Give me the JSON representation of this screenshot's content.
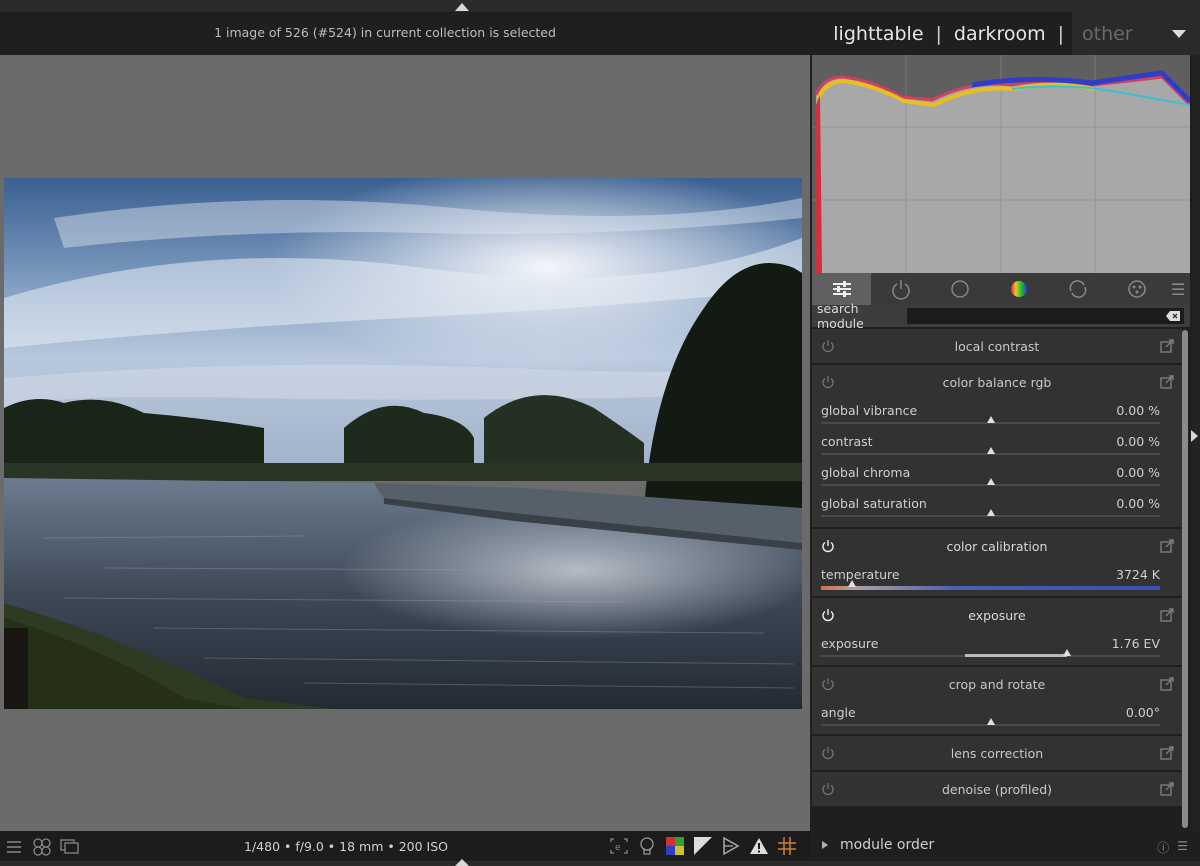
{
  "header": {
    "status_text": "1 image of 526 (#524) in current collection is selected",
    "views": [
      "lighttable",
      "darkroom"
    ],
    "view_separator": "|",
    "dropdown_label": "other"
  },
  "right_panel": {
    "tabs": [
      "quick-access-icon",
      "active-modules-icon",
      "base-icon",
      "color-icon",
      "correct-icon",
      "effect-icon"
    ],
    "search_label": "search module",
    "search_value": "",
    "modules": [
      {
        "name": "local contrast",
        "enabled": false,
        "sliders": []
      },
      {
        "name": "color balance rgb",
        "enabled": false,
        "sliders": [
          {
            "label": "global vibrance",
            "value": "0.00 %"
          },
          {
            "label": "contrast",
            "value": "0.00 %"
          },
          {
            "label": "global chroma",
            "value": "0.00 %"
          },
          {
            "label": "global saturation",
            "value": "0.00 %"
          }
        ]
      },
      {
        "name": "color calibration",
        "enabled": true,
        "sliders": [
          {
            "label": "temperature",
            "value": "3724 K"
          }
        ]
      },
      {
        "name": "exposure",
        "enabled": true,
        "sliders": [
          {
            "label": "exposure",
            "value": "1.76 EV"
          }
        ]
      },
      {
        "name": "crop and rotate",
        "enabled": false,
        "sliders": [
          {
            "label": "angle",
            "value": "0.00°"
          }
        ]
      },
      {
        "name": "lens correction",
        "enabled": false,
        "sliders": []
      },
      {
        "name": "denoise (profiled)",
        "enabled": false,
        "sliders": []
      }
    ]
  },
  "bottom": {
    "exif": "1/480 • f/9.0 • 18 mm • 200 ISO",
    "module_order_label": "module order"
  },
  "colors": {
    "accent_active": "#606060",
    "panel_bg": "#323232",
    "center_bg": "#6b6b6b"
  }
}
